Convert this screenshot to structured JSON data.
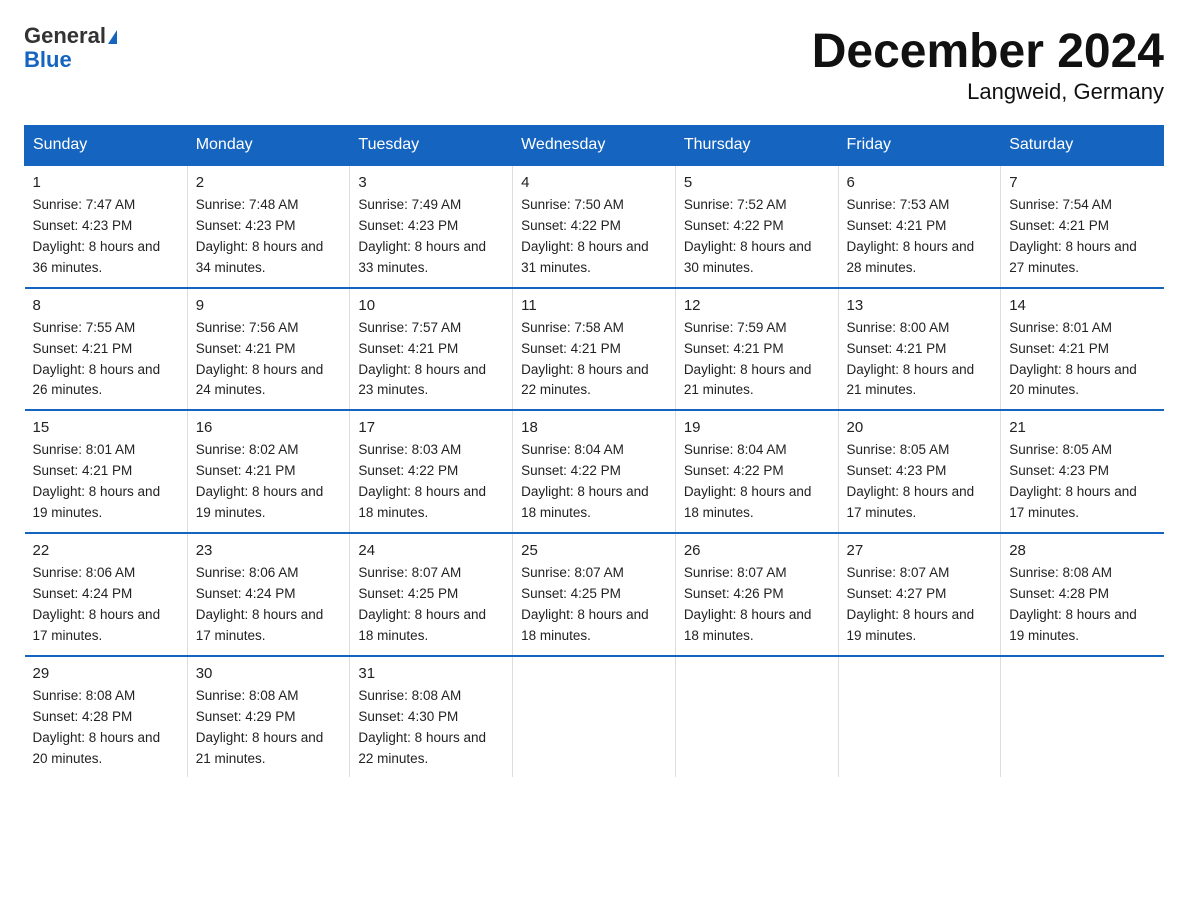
{
  "logo": {
    "general": "General",
    "blue": "Blue"
  },
  "title": "December 2024",
  "subtitle": "Langweid, Germany",
  "days_header": [
    "Sunday",
    "Monday",
    "Tuesday",
    "Wednesday",
    "Thursday",
    "Friday",
    "Saturday"
  ],
  "weeks": [
    [
      {
        "num": "1",
        "sunrise": "7:47 AM",
        "sunset": "4:23 PM",
        "daylight": "8 hours and 36 minutes."
      },
      {
        "num": "2",
        "sunrise": "7:48 AM",
        "sunset": "4:23 PM",
        "daylight": "8 hours and 34 minutes."
      },
      {
        "num": "3",
        "sunrise": "7:49 AM",
        "sunset": "4:23 PM",
        "daylight": "8 hours and 33 minutes."
      },
      {
        "num": "4",
        "sunrise": "7:50 AM",
        "sunset": "4:22 PM",
        "daylight": "8 hours and 31 minutes."
      },
      {
        "num": "5",
        "sunrise": "7:52 AM",
        "sunset": "4:22 PM",
        "daylight": "8 hours and 30 minutes."
      },
      {
        "num": "6",
        "sunrise": "7:53 AM",
        "sunset": "4:21 PM",
        "daylight": "8 hours and 28 minutes."
      },
      {
        "num": "7",
        "sunrise": "7:54 AM",
        "sunset": "4:21 PM",
        "daylight": "8 hours and 27 minutes."
      }
    ],
    [
      {
        "num": "8",
        "sunrise": "7:55 AM",
        "sunset": "4:21 PM",
        "daylight": "8 hours and 26 minutes."
      },
      {
        "num": "9",
        "sunrise": "7:56 AM",
        "sunset": "4:21 PM",
        "daylight": "8 hours and 24 minutes."
      },
      {
        "num": "10",
        "sunrise": "7:57 AM",
        "sunset": "4:21 PM",
        "daylight": "8 hours and 23 minutes."
      },
      {
        "num": "11",
        "sunrise": "7:58 AM",
        "sunset": "4:21 PM",
        "daylight": "8 hours and 22 minutes."
      },
      {
        "num": "12",
        "sunrise": "7:59 AM",
        "sunset": "4:21 PM",
        "daylight": "8 hours and 21 minutes."
      },
      {
        "num": "13",
        "sunrise": "8:00 AM",
        "sunset": "4:21 PM",
        "daylight": "8 hours and 21 minutes."
      },
      {
        "num": "14",
        "sunrise": "8:01 AM",
        "sunset": "4:21 PM",
        "daylight": "8 hours and 20 minutes."
      }
    ],
    [
      {
        "num": "15",
        "sunrise": "8:01 AM",
        "sunset": "4:21 PM",
        "daylight": "8 hours and 19 minutes."
      },
      {
        "num": "16",
        "sunrise": "8:02 AM",
        "sunset": "4:21 PM",
        "daylight": "8 hours and 19 minutes."
      },
      {
        "num": "17",
        "sunrise": "8:03 AM",
        "sunset": "4:22 PM",
        "daylight": "8 hours and 18 minutes."
      },
      {
        "num": "18",
        "sunrise": "8:04 AM",
        "sunset": "4:22 PM",
        "daylight": "8 hours and 18 minutes."
      },
      {
        "num": "19",
        "sunrise": "8:04 AM",
        "sunset": "4:22 PM",
        "daylight": "8 hours and 18 minutes."
      },
      {
        "num": "20",
        "sunrise": "8:05 AM",
        "sunset": "4:23 PM",
        "daylight": "8 hours and 17 minutes."
      },
      {
        "num": "21",
        "sunrise": "8:05 AM",
        "sunset": "4:23 PM",
        "daylight": "8 hours and 17 minutes."
      }
    ],
    [
      {
        "num": "22",
        "sunrise": "8:06 AM",
        "sunset": "4:24 PM",
        "daylight": "8 hours and 17 minutes."
      },
      {
        "num": "23",
        "sunrise": "8:06 AM",
        "sunset": "4:24 PM",
        "daylight": "8 hours and 17 minutes."
      },
      {
        "num": "24",
        "sunrise": "8:07 AM",
        "sunset": "4:25 PM",
        "daylight": "8 hours and 18 minutes."
      },
      {
        "num": "25",
        "sunrise": "8:07 AM",
        "sunset": "4:25 PM",
        "daylight": "8 hours and 18 minutes."
      },
      {
        "num": "26",
        "sunrise": "8:07 AM",
        "sunset": "4:26 PM",
        "daylight": "8 hours and 18 minutes."
      },
      {
        "num": "27",
        "sunrise": "8:07 AM",
        "sunset": "4:27 PM",
        "daylight": "8 hours and 19 minutes."
      },
      {
        "num": "28",
        "sunrise": "8:08 AM",
        "sunset": "4:28 PM",
        "daylight": "8 hours and 19 minutes."
      }
    ],
    [
      {
        "num": "29",
        "sunrise": "8:08 AM",
        "sunset": "4:28 PM",
        "daylight": "8 hours and 20 minutes."
      },
      {
        "num": "30",
        "sunrise": "8:08 AM",
        "sunset": "4:29 PM",
        "daylight": "8 hours and 21 minutes."
      },
      {
        "num": "31",
        "sunrise": "8:08 AM",
        "sunset": "4:30 PM",
        "daylight": "8 hours and 22 minutes."
      },
      null,
      null,
      null,
      null
    ]
  ]
}
